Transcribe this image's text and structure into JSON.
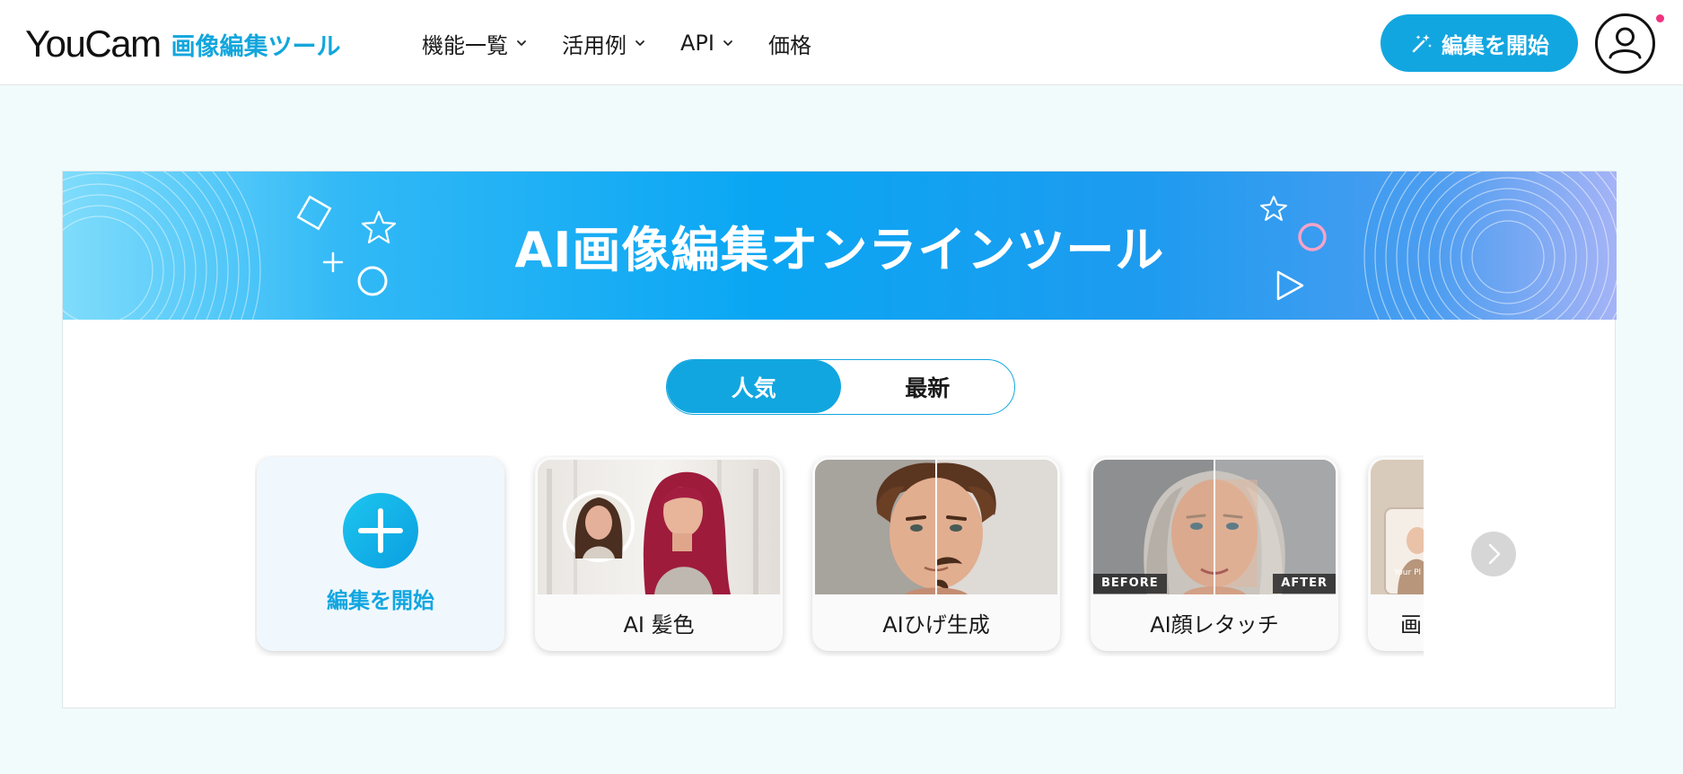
{
  "header": {
    "logo_main": "YouCam",
    "logo_sub": "画像編集ツール",
    "nav": [
      {
        "label": "機能一覧",
        "has_dropdown": true
      },
      {
        "label": "活用例",
        "has_dropdown": true
      },
      {
        "label": "API",
        "has_dropdown": true
      },
      {
        "label": "価格",
        "has_dropdown": false
      }
    ],
    "start_button": "編集を開始",
    "start_button_icon": "magic-wand-icon",
    "account_icon": "user-icon",
    "notification_color": "#f0337e"
  },
  "banner": {
    "title": "AI画像編集オンラインツール"
  },
  "tabs": [
    {
      "label": "人気",
      "active": true
    },
    {
      "label": "最新",
      "active": false
    }
  ],
  "cards": {
    "add_card_label": "編集を開始",
    "add_card_icon": "plus-icon",
    "items": [
      {
        "label": "AI 髪色"
      },
      {
        "label": "AIひげ生成"
      },
      {
        "label": "AI顔レタッチ",
        "before_badge": "BEFORE",
        "after_badge": "AFTER"
      },
      {
        "label": "画",
        "thumb_text": "Your Pl"
      }
    ]
  },
  "colors": {
    "accent": "#12a6e0",
    "page_bg": "#f1fbfc"
  }
}
